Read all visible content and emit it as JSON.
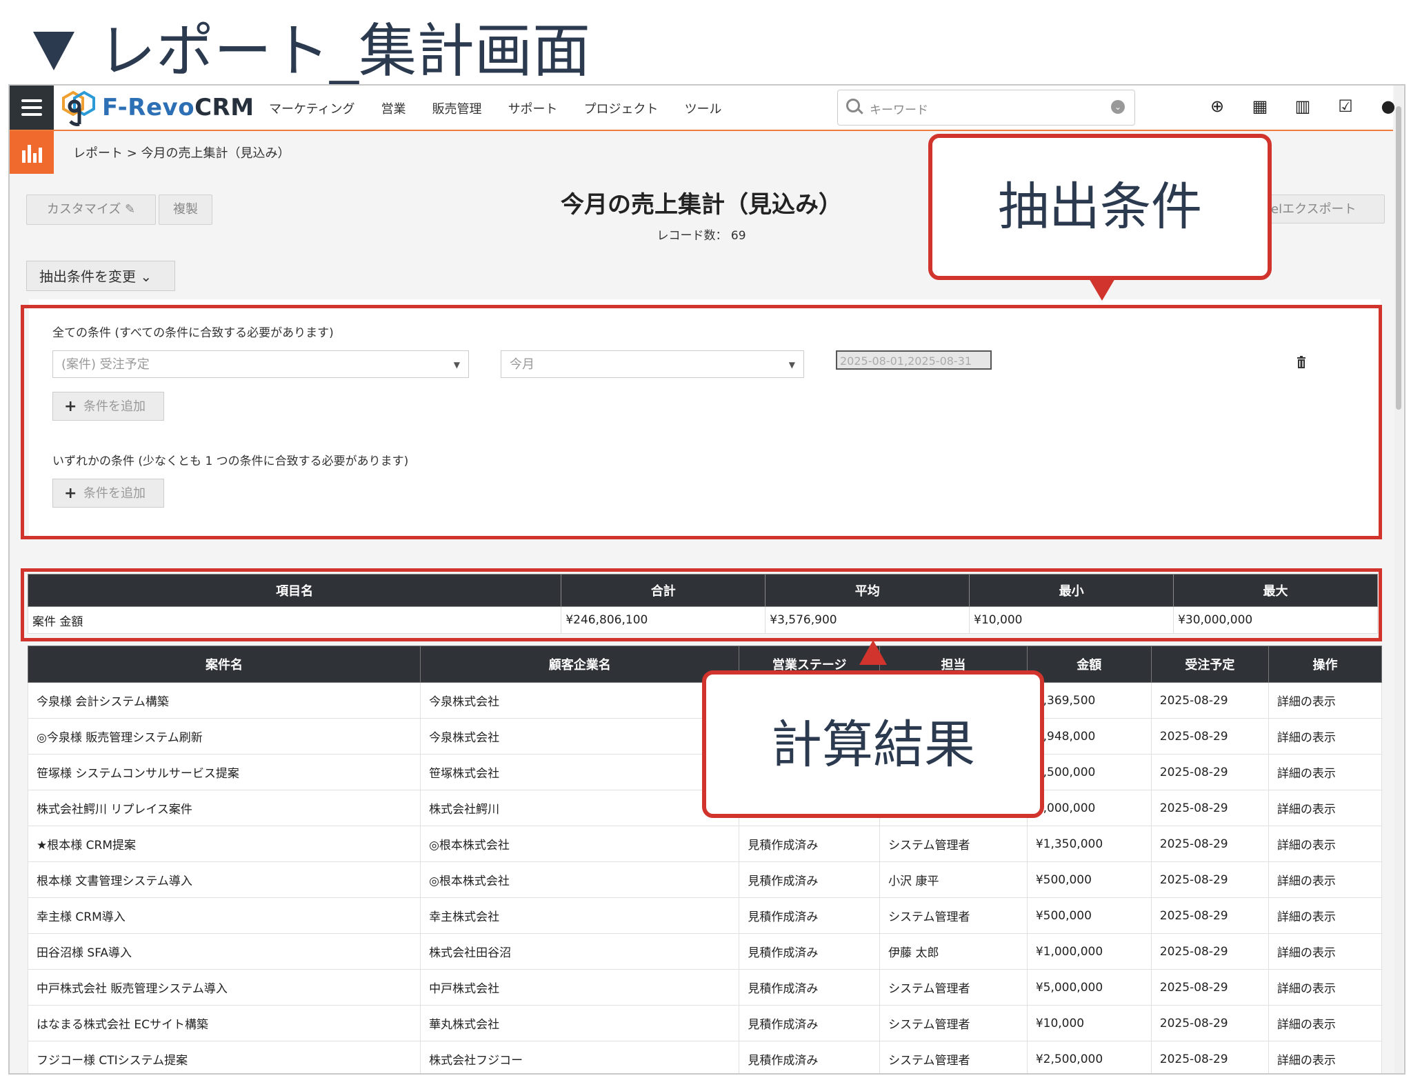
{
  "slide_title": "レポート_集計画面",
  "app": {
    "brand_prefix": "F-Revo",
    "brand_suffix": "CRM",
    "menu": [
      "マーケティング",
      "営業",
      "販売管理",
      "サポート",
      "プロジェクト",
      "ツール"
    ],
    "search_placeholder": "キーワード",
    "top_icons": [
      "plus-circle-icon",
      "calendar-icon",
      "chart-icon",
      "task-icon",
      "user-icon"
    ]
  },
  "breadcrumb": "レポート > 今月の売上集計（見込み）",
  "toolbar": {
    "customize_label": "カスタマイズ ✎",
    "duplicate_label": "複製",
    "excel_export_label": "elエクスポート"
  },
  "report": {
    "title": "今月の売上集計（見込み）",
    "record_count": "レコード数： 69"
  },
  "filter": {
    "toggle_label": "抽出条件を変更 ⌄",
    "all_conditions_label": "全ての条件 (すべての条件に合致する必要があります)",
    "field_select": "(案件) 受注予定",
    "operator_select": "今月",
    "date_value": "2025-08-01,2025-08-31",
    "add_condition_label": "条件を追加",
    "any_conditions_label": "いずれかの条件 (少なくとも 1 つの条件に合致する必要があります)"
  },
  "summary": {
    "headers": [
      "項目名",
      "合計",
      "平均",
      "最小",
      "最大"
    ],
    "row": [
      "案件 金額",
      "¥246,806,100",
      "¥3,576,900",
      "¥10,000",
      "¥30,000,000"
    ]
  },
  "table": {
    "headers": [
      "案件名",
      "顧客企業名",
      "営業ステージ",
      "担当",
      "金額",
      "受注予定",
      "操作"
    ],
    "rows": [
      [
        "今泉様 会計システム構築",
        "今泉株式会社",
        "",
        "",
        "5,369,500",
        "2025-08-29",
        "詳細の表示"
      ],
      [
        "◎今泉様 販売管理システム刷新",
        "今泉株式会社",
        "",
        "",
        "3,948,000",
        "2025-08-29",
        "詳細の表示"
      ],
      [
        "笹塚様 システムコンサルサービス提案",
        "笹塚株式会社",
        "",
        "",
        "1,500,000",
        "2025-08-29",
        "詳細の表示"
      ],
      [
        "株式会社鰐川 リプレイス案件",
        "株式会社鰐川",
        "",
        "",
        "1,000,000",
        "2025-08-29",
        "詳細の表示"
      ],
      [
        "★根本様 CRM提案",
        "◎根本株式会社",
        "見積作成済み",
        "システム管理者",
        "¥1,350,000",
        "2025-08-29",
        "詳細の表示"
      ],
      [
        "根本様 文書管理システム導入",
        "◎根本株式会社",
        "見積作成済み",
        "小沢 康平",
        "¥500,000",
        "2025-08-29",
        "詳細の表示"
      ],
      [
        "幸主様 CRM導入",
        "幸主株式会社",
        "見積作成済み",
        "システム管理者",
        "¥500,000",
        "2025-08-29",
        "詳細の表示"
      ],
      [
        "田谷沼様 SFA導入",
        "株式会社田谷沼",
        "見積作成済み",
        "伊藤 太郎",
        "¥1,000,000",
        "2025-08-29",
        "詳細の表示"
      ],
      [
        "中戸株式会社 販売管理システム導入",
        "中戸株式会社",
        "見積作成済み",
        "システム管理者",
        "¥5,000,000",
        "2025-08-29",
        "詳細の表示"
      ],
      [
        "はなまる株式会社 ECサイト構築",
        "華丸株式会社",
        "見積作成済み",
        "システム管理者",
        "¥10,000",
        "2025-08-29",
        "詳細の表示"
      ],
      [
        "フジコー様 CTIシステム提案",
        "株式会社フジコー",
        "見積作成済み",
        "システム管理者",
        "¥2,500,000",
        "2025-08-29",
        "詳細の表示"
      ]
    ]
  },
  "callouts": {
    "conditions": "抽出条件",
    "results": "計算結果"
  },
  "colors": {
    "accent": "#ef6a2c",
    "callout_red": "#d0342c",
    "header_dark": "#2f3338",
    "brand_blue": "#2d6fb4"
  }
}
